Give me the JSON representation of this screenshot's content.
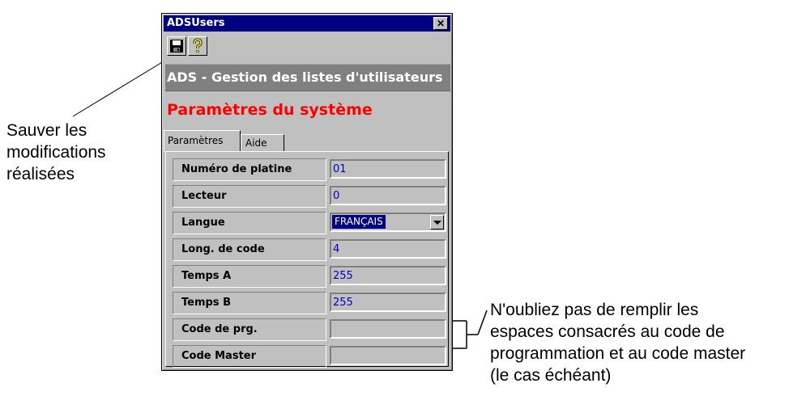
{
  "window": {
    "title": "ADSUsers",
    "close_glyph": "✕",
    "header": "ADS - Gestion des listes d'utilisateurs",
    "section_title": "Paramètres du système"
  },
  "toolbar": {
    "save_icon": "floppy-disk-icon",
    "help_icon": "help-question-icon"
  },
  "tabs": [
    {
      "label": "Paramètres",
      "active": true
    },
    {
      "label": "Aide",
      "active": false
    }
  ],
  "fields": [
    {
      "label": "Numéro de platine",
      "value": "01"
    },
    {
      "label": "Lecteur",
      "value": "0"
    },
    {
      "label": "Langue",
      "value": "FRANÇAIS"
    },
    {
      "label": "Long. de code",
      "value": "4"
    },
    {
      "label": "Temps A",
      "value": "255"
    },
    {
      "label": "Temps B",
      "value": "255"
    },
    {
      "label": "Code de prg.",
      "value": ""
    },
    {
      "label": "Code Master",
      "value": ""
    }
  ],
  "annotations": {
    "save": [
      "Sauver les",
      "modifications",
      "réalisées"
    ],
    "note": [
      "N'oubliez pas de remplir les",
      "espaces consacrés au code de",
      "programmation et au code master",
      "(le cas échéant)"
    ]
  },
  "colors": {
    "title_bar": "#000080",
    "section_title": "#ff0000",
    "field_text": "#0000c0"
  }
}
